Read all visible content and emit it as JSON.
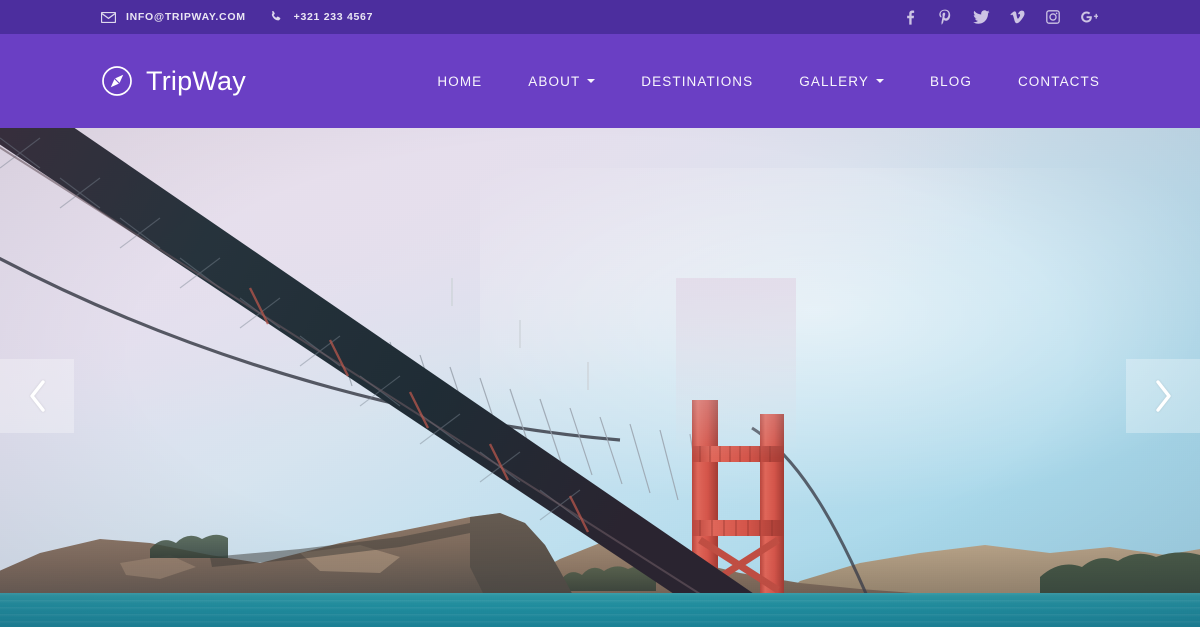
{
  "topbar": {
    "email_icon": "envelope-icon",
    "email": "INFO@TRIPWAY.COM",
    "phone_icon": "phone-icon",
    "phone": "+321 233 4567",
    "background_color": "#4c2e9e",
    "social": [
      {
        "name": "facebook",
        "icon": "facebook-icon",
        "label": "f"
      },
      {
        "name": "pinterest",
        "icon": "pinterest-icon",
        "label": "p"
      },
      {
        "name": "twitter",
        "icon": "twitter-icon",
        "label": "t"
      },
      {
        "name": "vimeo",
        "icon": "vimeo-icon",
        "label": "v"
      },
      {
        "name": "instagram",
        "icon": "instagram-icon",
        "label": "i"
      },
      {
        "name": "googleplus",
        "icon": "google-plus-icon",
        "label": "g+"
      }
    ]
  },
  "navbar": {
    "background_color": "#6a3fc4",
    "logo_icon": "compass-icon",
    "brand": "TripWay",
    "items": [
      {
        "label": "HOME",
        "has_dropdown": false
      },
      {
        "label": "ABOUT",
        "has_dropdown": true
      },
      {
        "label": "DESTINATIONS",
        "has_dropdown": false
      },
      {
        "label": "GALLERY",
        "has_dropdown": true
      },
      {
        "label": "BLOG",
        "has_dropdown": false
      },
      {
        "label": "CONTACTS",
        "has_dropdown": false
      }
    ]
  },
  "hero": {
    "scene": "Golden Gate Bridge from below, Marin headlands, teal bay water, hazy pastel sky",
    "prev_icon": "chevron-left-icon",
    "next_icon": "chevron-right-icon",
    "colors": {
      "sky_top_left": "#e8dfee",
      "sky_bottom_right": "#9fd3e6",
      "bridge_red": "#d4554a",
      "truss_dark": "#2b3a44",
      "hill_brown": "#8b7263",
      "water_teal": "#1f8fa0",
      "arrow_overlay": "rgba(255,255,255,0.30)"
    }
  }
}
